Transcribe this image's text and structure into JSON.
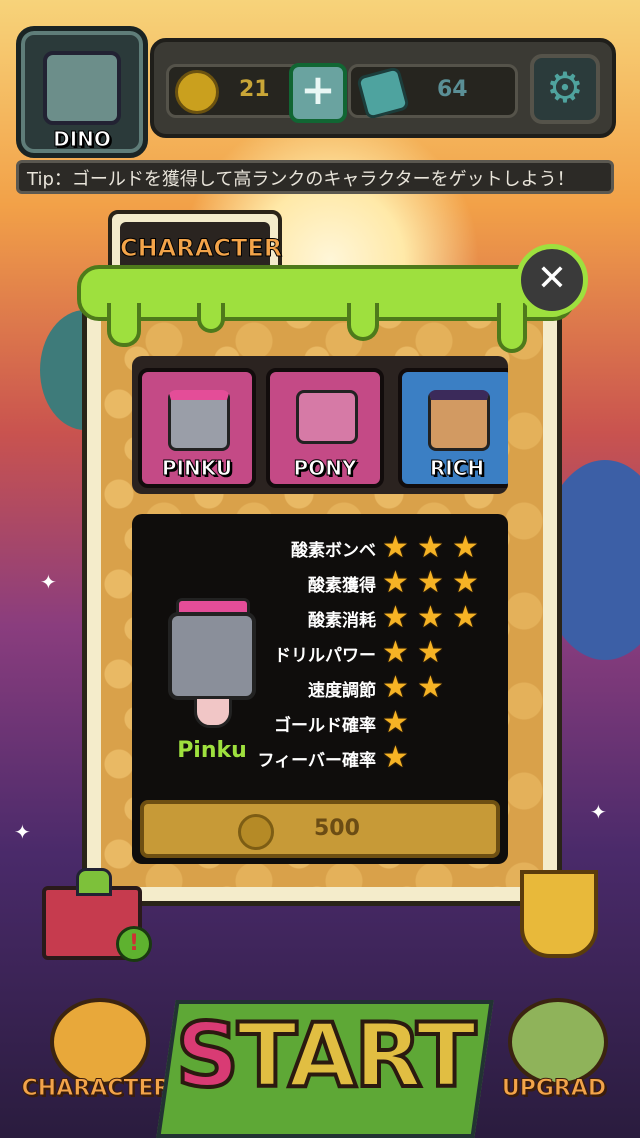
{
  "player": {
    "name": "DINO"
  },
  "resources": {
    "gold": "21",
    "gems": "64"
  },
  "tip": "Tip：ゴールドを獲得して高ランクのキャラクターをゲットしよう！",
  "panel": {
    "tab_label": "CHARACTER",
    "characters": [
      {
        "label": "PINKU",
        "color": "#c44a86"
      },
      {
        "label": "PONY",
        "color": "#c44a86"
      },
      {
        "label": "RICH",
        "color": "#3b7fc4"
      }
    ],
    "selected": {
      "name": "Pinku",
      "stats": [
        {
          "label": "酸素ボンベ",
          "stars": 3
        },
        {
          "label": "酸素獲得",
          "stars": 3
        },
        {
          "label": "酸素消耗",
          "stars": 3
        },
        {
          "label": "ドリルパワー",
          "stars": 2
        },
        {
          "label": "速度調節",
          "stars": 2
        },
        {
          "label": "ゴールド確率",
          "stars": 1
        },
        {
          "label": "フィーバー確率",
          "stars": 1
        }
      ],
      "price": "500"
    }
  },
  "bottom_nav": {
    "character_label": "CHARACTER",
    "start_label_s": "S",
    "start_label_rest": "TART",
    "upgrade_label": "UPGRAD"
  },
  "icons": {
    "settings": "gear-icon",
    "close": "close-icon",
    "add_gold": "plus-icon"
  }
}
